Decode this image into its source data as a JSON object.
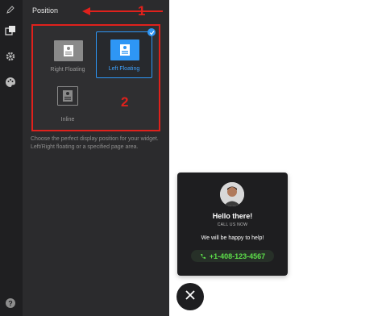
{
  "panel": {
    "title": "Position",
    "options": [
      {
        "label": "Right Floating",
        "selected": false
      },
      {
        "label": "Left Floating",
        "selected": true
      },
      {
        "label": "Inline",
        "selected": false
      }
    ],
    "help_text": "Choose the perfect display position for your widget. Left/Right floating or a specified page area."
  },
  "annotations": {
    "marker_1": "1",
    "marker_2": "2",
    "color": "#e0211c"
  },
  "rail_icons": [
    "pencil-icon",
    "layers-icon",
    "gear-icon",
    "palette-icon",
    "help-icon"
  ],
  "widget": {
    "greeting": "Hello there!",
    "subtitle": "CALL US NOW",
    "message": "We will be happy to help!",
    "phone": "+1-408-123-4567",
    "accent_color": "#5de04a"
  },
  "colors": {
    "selected": "#2e96f5",
    "panel_bg": "#2b2b2d",
    "rail_bg": "#1f1f21"
  }
}
